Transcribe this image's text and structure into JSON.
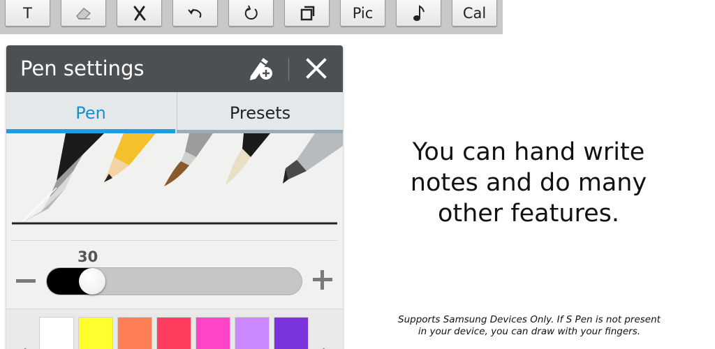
{
  "toolbar": {
    "buttons": [
      {
        "label": "T",
        "icon": "text-icon"
      },
      {
        "label": "",
        "icon": "eraser-icon"
      },
      {
        "label": "",
        "icon": "cross-mark-icon"
      },
      {
        "label": "",
        "icon": "undo-icon"
      },
      {
        "label": "",
        "icon": "redo-icon"
      },
      {
        "label": "",
        "icon": "copy-window-icon"
      },
      {
        "label": "Pic",
        "icon": ""
      },
      {
        "label": "",
        "icon": "music-note-icon"
      },
      {
        "label": "Cal",
        "icon": ""
      }
    ]
  },
  "pen_settings": {
    "title": "Pen settings",
    "tabs": {
      "pen": "Pen",
      "presets": "Presets"
    },
    "active_tab": "Pen",
    "pens": [
      "ballpoint-pen-icon",
      "pencil-icon",
      "brush-icon",
      "calligraphy-brush-icon",
      "marker-icon"
    ],
    "size": {
      "value": "30",
      "fraction": 0.14
    }
  },
  "palette": {
    "colors": [
      "#ffffff",
      "#ffff2e",
      "#ff7f55",
      "#ff3d5e",
      "#ff44c8",
      "#cc88ff",
      "#7a33dd"
    ]
  },
  "colors": {
    "header": "#4c5052",
    "accent": "#1f9de0"
  },
  "promo": {
    "text": "You can hand write notes and do many other features."
  },
  "disclaimer": {
    "text": "Supports Samsung Devices Only. If S Pen is not present in your device, you can draw with your fingers."
  }
}
